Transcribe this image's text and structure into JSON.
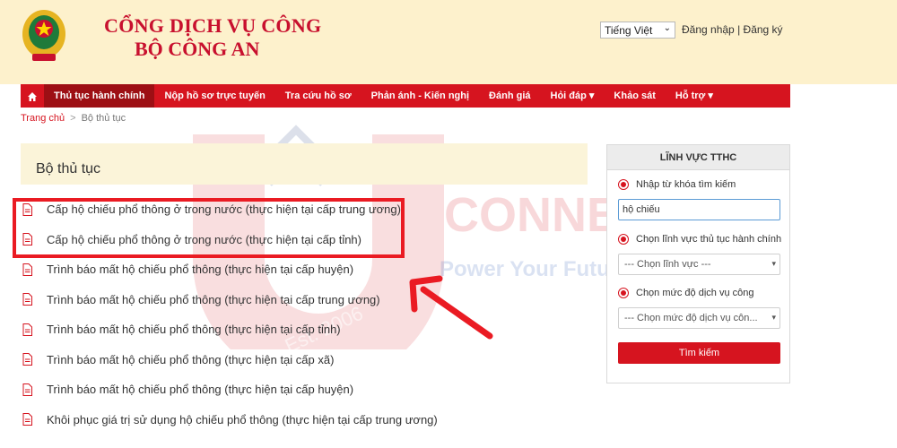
{
  "header": {
    "title_line1": "CỔNG DỊCH VỤ CÔNG",
    "title_line2": "BỘ CÔNG AN",
    "language": "Tiếng Việt",
    "login": "Đăng nhập",
    "separator": "|",
    "register": "Đăng ký"
  },
  "nav": {
    "home_icon": "home-icon",
    "items": [
      {
        "label": "Thủ tục hành chính",
        "active": true
      },
      {
        "label": "Nộp hồ sơ trực tuyến"
      },
      {
        "label": "Tra cứu hồ sơ"
      },
      {
        "label": "Phản ánh - Kiến nghị"
      },
      {
        "label": "Đánh giá"
      },
      {
        "label": "Hỏi đáp ▾"
      },
      {
        "label": "Khảo sát"
      },
      {
        "label": "Hỗ trợ ▾"
      }
    ]
  },
  "breadcrumb": {
    "home": "Trang chủ",
    "separator": ">",
    "current": "Bộ thủ tục"
  },
  "main": {
    "title": "Bộ thủ tục",
    "procedures": [
      "Cấp hộ chiếu phổ thông ở trong nước (thực hiện tại cấp trung ương)",
      "Cấp hộ chiếu phổ thông ở trong nước (thực hiện tại cấp tỉnh)",
      "Trình báo mất hộ chiếu phổ thông (thực hiện tại cấp huyện)",
      "Trình báo mất hộ chiếu phổ thông (thực hiện tại cấp trung ương)",
      "Trình báo mất hộ chiếu phổ thông (thực hiện tại cấp tỉnh)",
      "Trình báo mất hộ chiếu phổ thông (thực hiện tại cấp xã)",
      "Trình báo mất hộ chiếu phổ thông (thực hiện tại cấp huyện)",
      "Khôi phục giá trị sử dụng hộ chiếu phổ thông (thực hiện tại cấp trung ương)"
    ]
  },
  "watermark": {
    "brand": "CONNECT",
    "tagline": "Power Your Future",
    "est": "Est. 2006"
  },
  "sidebar": {
    "title": "LĨNH VỰC TTHC",
    "keyword_label": "Nhập từ khóa tìm kiếm",
    "keyword_value": "hộ chiếu",
    "field_label": "Chọn lĩnh vực thủ tục hành chính",
    "field_placeholder": "--- Chọn lĩnh vực ---",
    "level_label": "Chọn mức độ dịch vụ công",
    "level_placeholder": "--- Chọn mức độ dịch vụ côn...",
    "search_button": "Tìm kiếm"
  },
  "colors": {
    "brand_red": "#d6141f",
    "header_bg": "#fdf1cc",
    "highlight": "#ea1b23"
  }
}
